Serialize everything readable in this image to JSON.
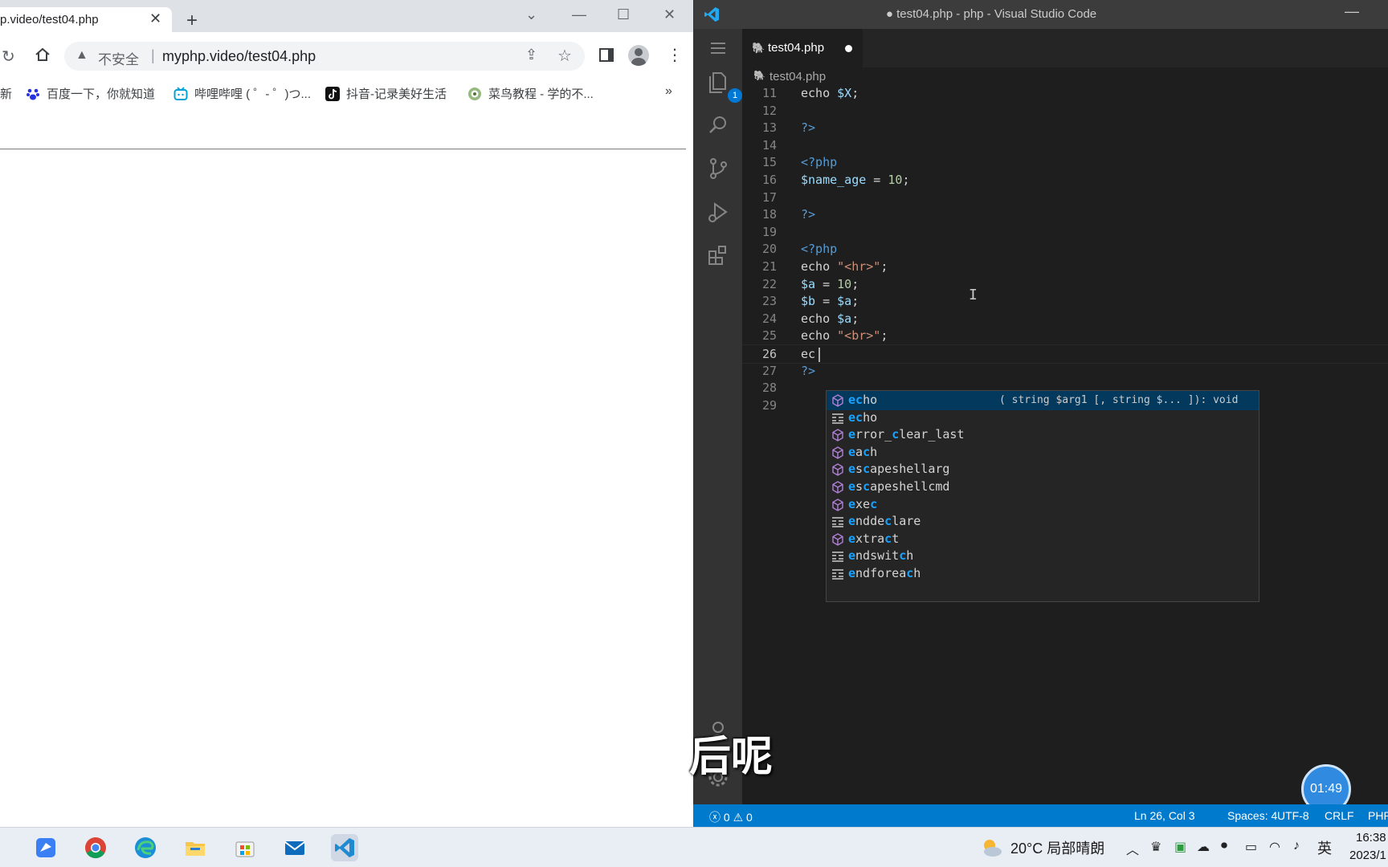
{
  "browser": {
    "tab_title": "p.video/test04.php",
    "tab_close": "✕",
    "new_tab": "+",
    "insecure_label": "不安全",
    "url": "myphp.video/test04.php",
    "bookmark_first_fragment": "新",
    "bookmarks": [
      "百度一下，你就知道",
      "哔哩哔哩 ( ゜- ゜)つ...",
      "抖音-记录美好生活",
      "菜鸟教程 - 学的不..."
    ],
    "bookmarks_more": "»"
  },
  "vscode": {
    "window_title": "● test04.php - php - Visual Studio Code",
    "tab_name": "test04.php",
    "breadcrumb": "test04.php",
    "explorer_badge": "1",
    "code_lines": [
      {
        "n": "11",
        "text": "echo $X;"
      },
      {
        "n": "12",
        "text": ""
      },
      {
        "n": "13",
        "text": "?>"
      },
      {
        "n": "14",
        "text": ""
      },
      {
        "n": "15",
        "text": "<?php"
      },
      {
        "n": "16",
        "text": "$name_age = 10;"
      },
      {
        "n": "17",
        "text": ""
      },
      {
        "n": "18",
        "text": "?>"
      },
      {
        "n": "19",
        "text": ""
      },
      {
        "n": "20",
        "text": "<?php"
      },
      {
        "n": "21",
        "text": "echo \"<hr>\";"
      },
      {
        "n": "22",
        "text": "$a = 10;"
      },
      {
        "n": "23",
        "text": "$b = $a;"
      },
      {
        "n": "24",
        "text": "echo $a;"
      },
      {
        "n": "25",
        "text": "echo \"<br>\";"
      },
      {
        "n": "26",
        "text": "ec"
      },
      {
        "n": "27",
        "text": "?>"
      },
      {
        "n": "28",
        "text": ""
      },
      {
        "n": "29",
        "text": ""
      }
    ],
    "suggestions": [
      {
        "label": "echo",
        "kind": "function",
        "detail": "( string $arg1 [, string $... ]): void"
      },
      {
        "label": "echo",
        "kind": "snippet",
        "detail": ""
      },
      {
        "label": "error_clear_last",
        "kind": "function",
        "detail": ""
      },
      {
        "label": "each",
        "kind": "function",
        "detail": ""
      },
      {
        "label": "escapeshellarg",
        "kind": "function",
        "detail": ""
      },
      {
        "label": "escapeshellcmd",
        "kind": "function",
        "detail": ""
      },
      {
        "label": "exec",
        "kind": "function",
        "detail": ""
      },
      {
        "label": "enddeclare",
        "kind": "snippet",
        "detail": ""
      },
      {
        "label": "extract",
        "kind": "function",
        "detail": ""
      },
      {
        "label": "endswitch",
        "kind": "snippet",
        "detail": ""
      },
      {
        "label": "endforeach",
        "kind": "snippet",
        "detail": ""
      }
    ],
    "status": {
      "errors": "0",
      "warnings": "0",
      "position": "Ln 26, Col 3",
      "spaces": "Spaces: 4",
      "encoding": "UTF-8",
      "eol": "CRLF",
      "language": "PHP"
    }
  },
  "overlay": {
    "subtitle": "后呢",
    "timer": "01:49"
  },
  "taskbar": {
    "weather_temp": "20°C",
    "weather_desc": "局部晴朗",
    "ime": "英",
    "time": "16:38",
    "date": "2023/1"
  },
  "colors": {
    "vscode_bg": "#1e1e1e",
    "statusbar": "#007acc",
    "keyword": "#569cd6",
    "string": "#ce9178",
    "variable": "#9cdcfe",
    "number": "#b5cea8",
    "match_highlight": "#18a3ff"
  }
}
